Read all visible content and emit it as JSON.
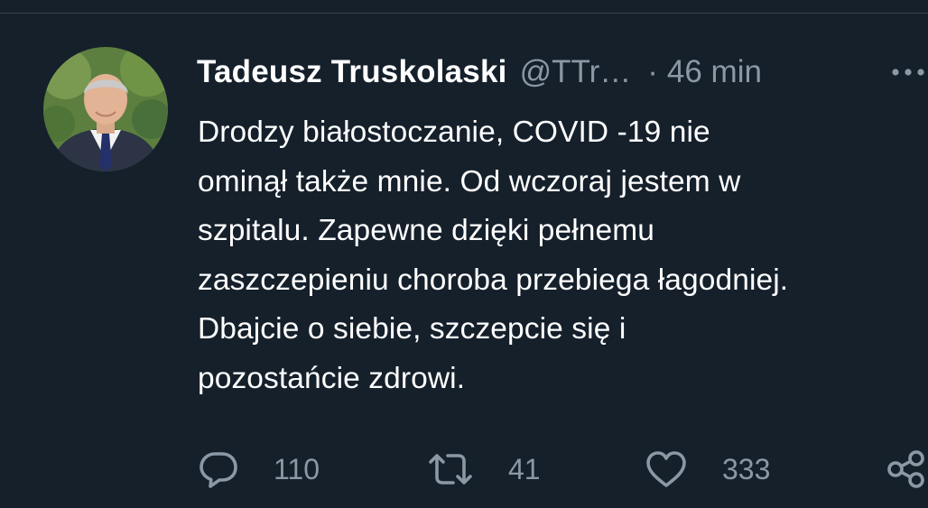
{
  "tweet": {
    "author": {
      "display_name": "Tadeusz Truskolaski",
      "handle": "@TTr…",
      "avatar": "profile-photo"
    },
    "separator": "·",
    "time": "46 min",
    "text": "Drodzy białostoczanie, COVID -19 nie\nominął także mnie. Od wczoraj jestem w\nszpitalu. Zapewne dzięki pełnemu\nzaszczepieniu choroba przebiega łagodniej.\nDbajcie o siebie, szczepcie się i\npozostańcie zdrowi.",
    "more_icon": "more-horizontal-icon",
    "actions": {
      "reply": {
        "icon": "reply-icon",
        "count": "110"
      },
      "retweet": {
        "icon": "retweet-icon",
        "count": "41"
      },
      "like": {
        "icon": "like-icon",
        "count": "333"
      },
      "share": {
        "icon": "share-icon"
      }
    }
  },
  "colors": {
    "background": "#15202b",
    "primary_text": "#ffffff",
    "secondary_text": "#8b98a5",
    "divider": "#38444d"
  }
}
